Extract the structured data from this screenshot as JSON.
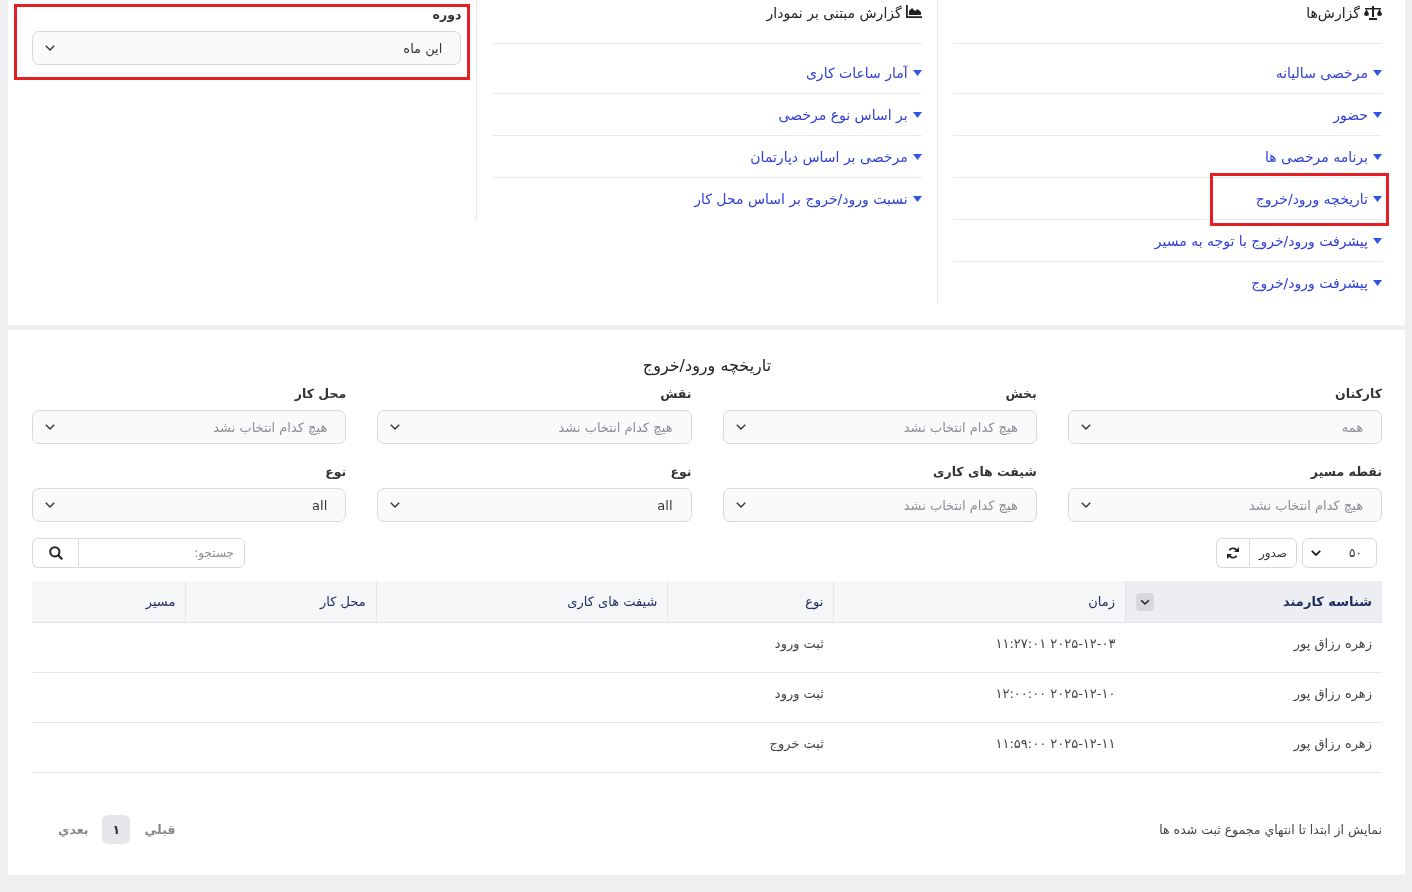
{
  "reports": {
    "title": "گزارش‌ها",
    "items": [
      {
        "label": "مرخصی سالیانه",
        "highlighted": false
      },
      {
        "label": "حضور",
        "highlighted": false
      },
      {
        "label": "برنامه مرخصی ها",
        "highlighted": false
      },
      {
        "label": "تاریخچه ورود/خروج",
        "highlighted": true
      },
      {
        "label": "پیشرفت ورود/خروج با توجه به مسیر",
        "highlighted": false
      },
      {
        "label": "پیشرفت ورود/خروج",
        "highlighted": false
      }
    ]
  },
  "chart_reports": {
    "title": "گزارش مبتنی بر نمودار",
    "items": [
      {
        "label": "آمار ساعات کاری",
        "highlighted": false
      },
      {
        "label": "بر اساس نوع مرخصی",
        "highlighted": false
      },
      {
        "label": "مرخصی بر اساس دپارتمان",
        "highlighted": false
      },
      {
        "label": "نسبت ورود/خروج بر اساس محل کار",
        "highlighted": false
      }
    ]
  },
  "period_filter": {
    "label": "دوره",
    "value": "این ماه",
    "highlighted": true
  },
  "attendance_history": {
    "title": "تاریخچه ورود/خروج",
    "filters": [
      {
        "label": "کارکنان",
        "placeholder": "همه"
      },
      {
        "label": "بخش",
        "placeholder": "هیچ کدام انتخاب نشد"
      },
      {
        "label": "نقش",
        "placeholder": "هیچ کدام انتخاب نشد"
      },
      {
        "label": "محل کار",
        "placeholder": "هیچ کدام انتخاب نشد"
      },
      {
        "label": "نقطه مسیر",
        "placeholder": "هیچ کدام انتخاب نشد"
      },
      {
        "label": "شیفت های کاری",
        "placeholder": "هیچ کدام انتخاب نشد"
      },
      {
        "label": "نوع",
        "value": "all"
      },
      {
        "label": "نوع",
        "value": "all"
      }
    ],
    "page_size": "۵۰",
    "export_button": "صدور",
    "search": {
      "placeholder": "جستجو:"
    },
    "table": {
      "columns": [
        {
          "label": "شناسه کارمند",
          "sorted": true
        },
        {
          "label": "زمان",
          "sorted": false
        },
        {
          "label": "نوع",
          "sorted": false
        },
        {
          "label": "شیفت های کاری",
          "sorted": false
        },
        {
          "label": "محل کار",
          "sorted": false
        },
        {
          "label": "مسیر",
          "sorted": false
        }
      ],
      "rows": [
        {
          "cells": [
            "زهره رزاق پور",
            "۲۰۲۵-۱۲-۰۳ ۱۱:۲۷:۰۱",
            "ثبت ورود"
          ]
        },
        {
          "cells": [
            "زهره رزاق پور",
            "۲۰۲۵-۱۲-۱۰ ۱۲:۰۰:۰۰",
            "ثبت ورود"
          ]
        },
        {
          "cells": [
            "زهره رزاق پور",
            "۲۰۲۵-۱۲-۱۱ ۱۱:۵۹:۰۰",
            "ثبت خروج"
          ]
        }
      ]
    },
    "summary": "نمایش از ابتدا تا انتهاي مجموع ثبت شده ها",
    "pagination": [
      {
        "label": "قبلي",
        "selected": false
      },
      {
        "label": "۱",
        "selected": true
      },
      {
        "label": "بعدي",
        "selected": false
      }
    ]
  }
}
